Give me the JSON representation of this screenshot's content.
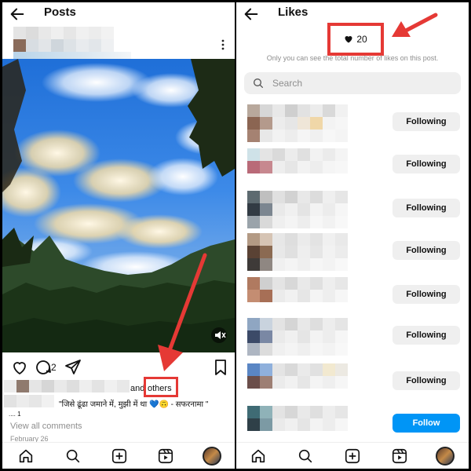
{
  "left": {
    "header": {
      "title": "Posts"
    },
    "post": {
      "comment_count": "2",
      "likes_suffix": "and",
      "likes_others": "others",
      "caption": "\"जिसे ढूंढा जमाने में, मुझी में था 💙🙃 - सफरनामा \"",
      "ellipsis": ".... 1",
      "view_comments": "View all comments",
      "date": "February 26"
    }
  },
  "right": {
    "header": {
      "title": "Likes"
    },
    "likes_count": "20",
    "privacy_note": "Only you can see the total number of likes on this post.",
    "search_placeholder": "Search",
    "users": [
      {
        "button": "Following"
      },
      {
        "button": "Following"
      },
      {
        "button": "Following"
      },
      {
        "button": "Following"
      },
      {
        "button": "Following"
      },
      {
        "button": "Following"
      },
      {
        "button": "Following"
      },
      {
        "button": "Follow"
      }
    ]
  },
  "colors": {
    "highlight": "#e53935",
    "follow_blue": "#0095f6",
    "button_gray": "#efefef"
  },
  "icons": [
    "back-arrow-icon",
    "more-options-icon",
    "heart-icon",
    "comment-icon",
    "share-icon",
    "bookmark-icon",
    "mute-icon",
    "home-icon",
    "search-icon",
    "create-icon",
    "reels-icon"
  ]
}
